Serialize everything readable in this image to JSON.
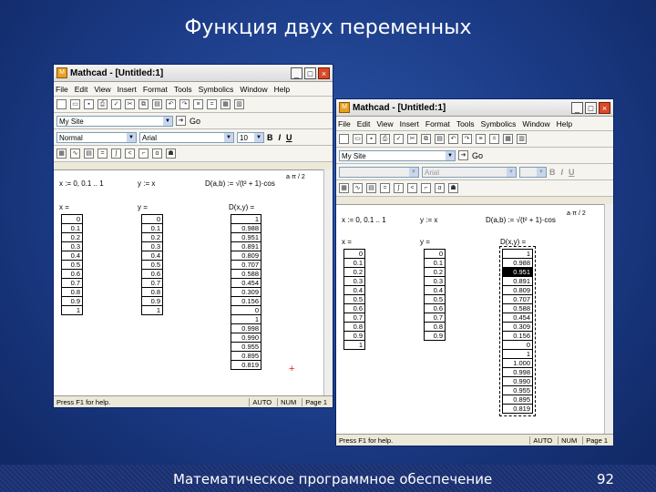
{
  "slide": {
    "title": "Функция двух переменных",
    "footer": "Математическое программное обеспечение",
    "page_number": "92"
  },
  "window1": {
    "title": "Mathcad - [Untitled:1]",
    "menu": [
      "File",
      "Edit",
      "View",
      "Insert",
      "Format",
      "Tools",
      "Symbolics",
      "Window",
      "Help"
    ],
    "style_value": "My Site",
    "format_style": "Normal",
    "font": "Arial",
    "font_size": "10",
    "go_label": "Go",
    "def_x": "x := 0, 0.1 .. 1",
    "def_y": "y := x",
    "def_d": "D(a,b) := √(t² + 1)·cos",
    "frac": "a·π / 2",
    "x_label": "x =",
    "y_label": "y =",
    "d_label": "D(x,y) =",
    "x_values": [
      "0",
      "0.1",
      "0.2",
      "0.3",
      "0.4",
      "0.5",
      "0.6",
      "0.7",
      "0.8",
      "0.9",
      "1"
    ],
    "y_values": [
      "0",
      "0.1",
      "0.2",
      "0.3",
      "0.4",
      "0.5",
      "0.6",
      "0.7",
      "0.8",
      "0.9",
      "1"
    ],
    "d_values": [
      "1",
      "0.988",
      "0.951",
      "0.891",
      "0.809",
      "0.707",
      "0.588",
      "0.454",
      "0.309",
      "0.156",
      "0",
      "1",
      "0.998",
      "0.990",
      "0.955",
      "0.895",
      "0.819"
    ],
    "status_hint": "Press F1 for help.",
    "status_auto": "AUTO",
    "status_num": "NUM",
    "status_page": "Page 1"
  },
  "window2": {
    "title": "Mathcad - [Untitled:1]",
    "menu": [
      "File",
      "Edit",
      "View",
      "Insert",
      "Format",
      "Tools",
      "Symbolics",
      "Window",
      "Help"
    ],
    "style_value": "My Site",
    "font": "Arial",
    "go_label": "Go",
    "def_x": "x := 0, 0.1 .. 1",
    "def_y": "y := x",
    "def_d": "D(a,b) := √(t² + 1)·cos",
    "frac": "a·π / 2",
    "x_label": "x =",
    "y_label": "y =",
    "d_label": "D(x,y) =",
    "x_values": [
      "0",
      "0.1",
      "0.2",
      "0.3",
      "0.4",
      "0.5",
      "0.6",
      "0.7",
      "0.8",
      "0.9",
      "1"
    ],
    "y_values": [
      "0",
      "0.1",
      "0.2",
      "0.3",
      "0.4",
      "0.5",
      "0.6",
      "0.7",
      "0.8",
      "0.9"
    ],
    "d_values": [
      "1",
      "0.988",
      "0.951",
      "0.891",
      "0.809",
      "0.707",
      "0.588",
      "0.454",
      "0.309",
      "0.156",
      "0",
      "1",
      "1.000",
      "0.998",
      "0.990",
      "0.955",
      "0.895",
      "0.819"
    ],
    "status_hint": "Press F1 for help.",
    "status_auto": "AUTO",
    "status_num": "NUM",
    "status_page": "Page 1"
  },
  "colors": {
    "background": "#1b3a85",
    "highlight": "#000000",
    "marker": "#e02020"
  }
}
